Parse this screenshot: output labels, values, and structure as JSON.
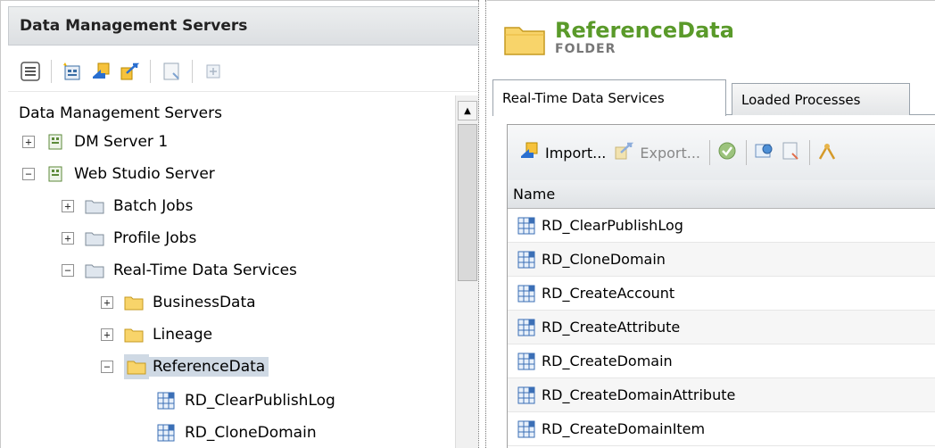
{
  "left_panel": {
    "header_title": "Data Management Servers",
    "toolbar_icons": [
      "view-icon",
      "new-job-icon",
      "import-icon",
      "export-icon",
      "properties-icon",
      "expand-icon"
    ],
    "tree": {
      "root_label": "Data Management Servers",
      "nodes": [
        {
          "label": "DM Server 1",
          "expander": "+"
        },
        {
          "label": "Web Studio Server",
          "expander": "−"
        },
        {
          "label": "Batch Jobs",
          "expander": "+"
        },
        {
          "label": "Profile Jobs",
          "expander": "+"
        },
        {
          "label": "Real-Time Data Services",
          "expander": "−"
        },
        {
          "label": "BusinessData",
          "expander": "+"
        },
        {
          "label": "Lineage",
          "expander": "+"
        },
        {
          "label": "ReferenceData",
          "expander": "−"
        },
        {
          "label": "RD_ClearPublishLog",
          "expander": ""
        },
        {
          "label": "RD_CloneDomain",
          "expander": ""
        }
      ]
    }
  },
  "right_panel": {
    "folder_title": "ReferenceData",
    "folder_type": "FOLDER",
    "tabs": [
      {
        "label": "Real-Time Data Services"
      },
      {
        "label": "Loaded Processes"
      }
    ],
    "toolbar": {
      "import_label": "Import...",
      "export_label": "Export..."
    },
    "grid": {
      "column_name": "Name",
      "rows": [
        "RD_ClearPublishLog",
        "RD_CloneDomain",
        "RD_CreateAccount",
        "RD_CreateAttribute",
        "RD_CreateDomain",
        "RD_CreateDomainAttribute",
        "RD_CreateDomainItem"
      ]
    }
  },
  "colors": {
    "folder_title": "#5a9a2a",
    "selection": "#cfd9e4",
    "folder_yellow": "#f2c54a"
  }
}
